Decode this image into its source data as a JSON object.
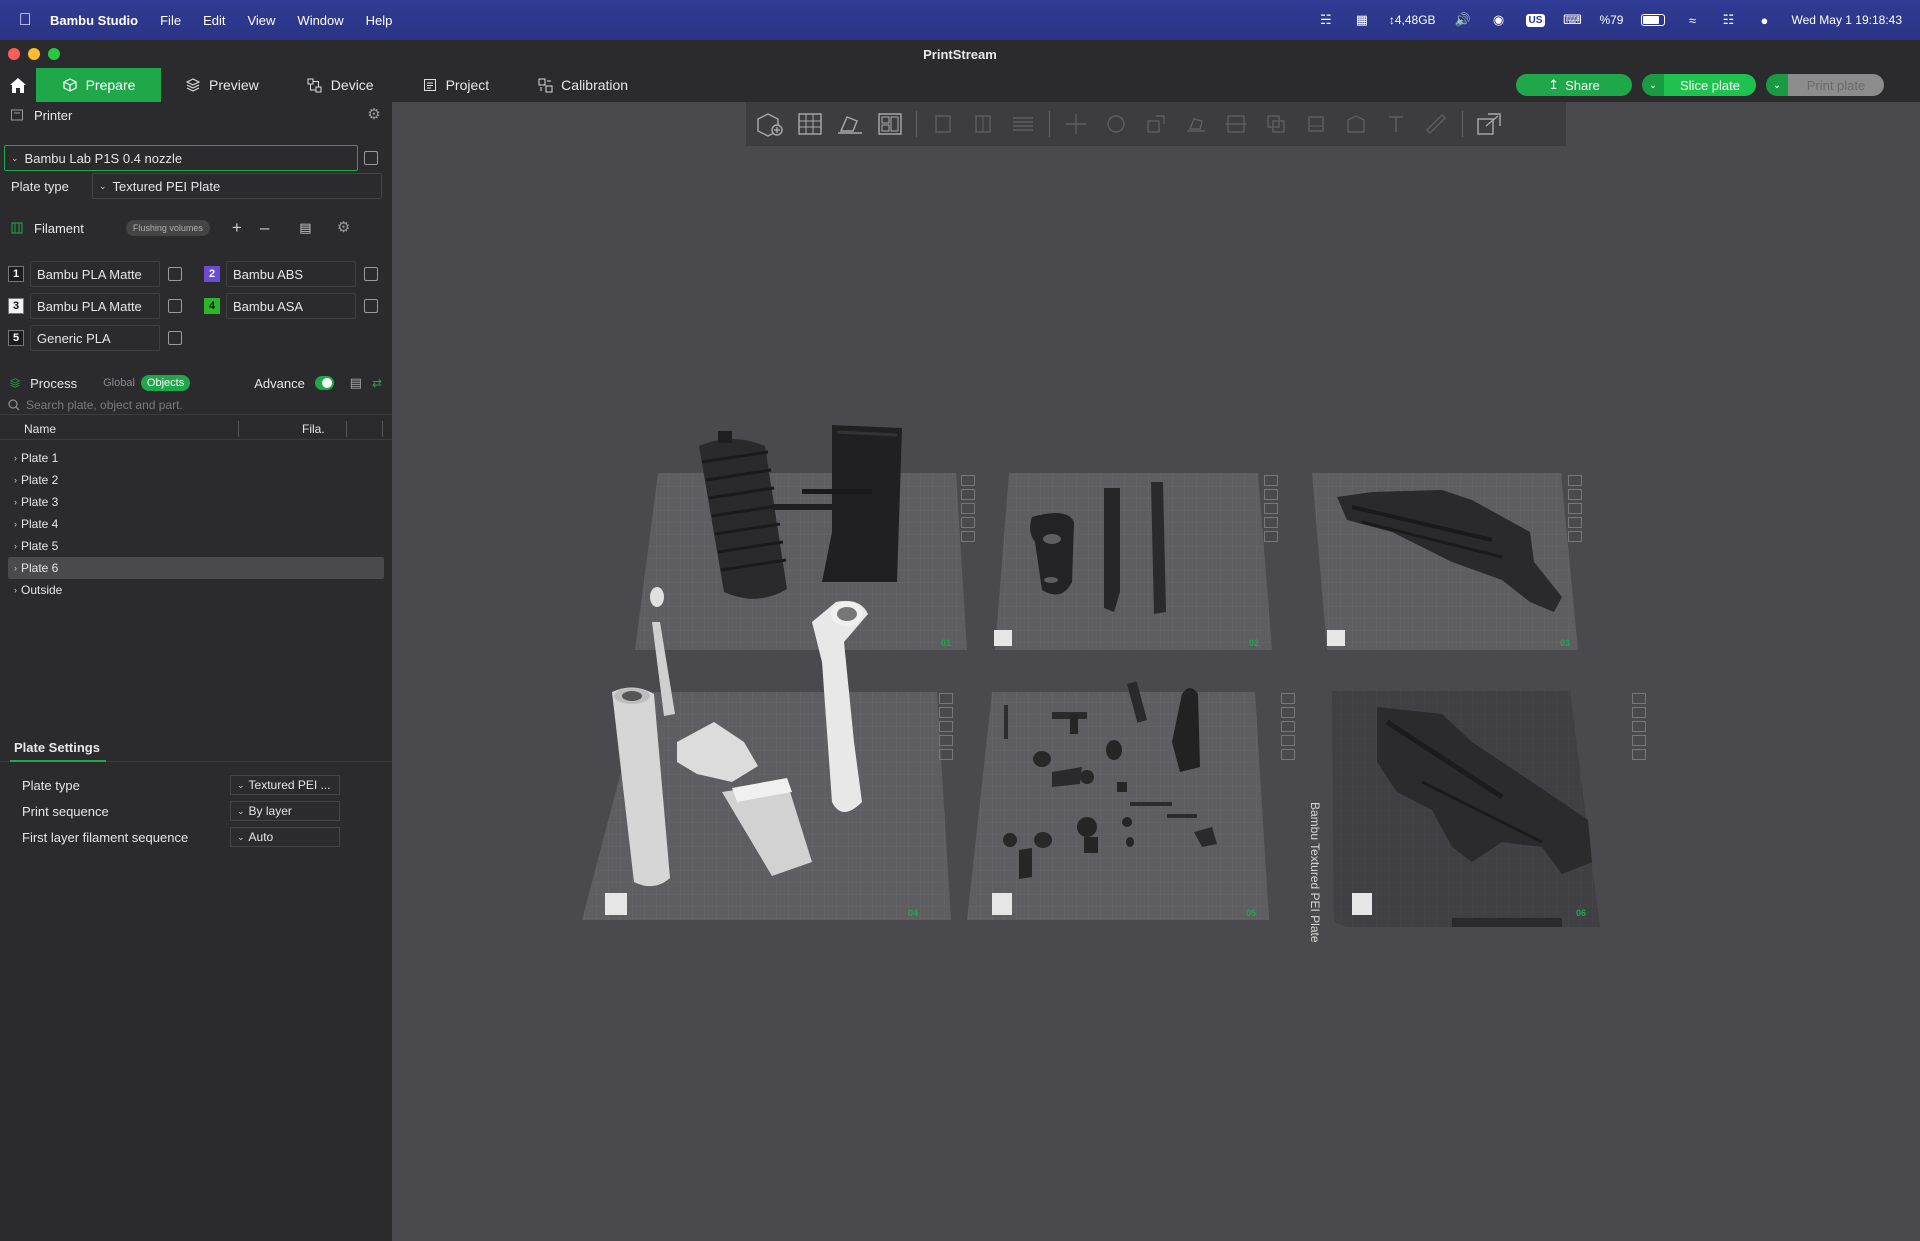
{
  "menubar": {
    "app_name": "Bambu Studio",
    "menus": [
      "File",
      "Edit",
      "View",
      "Window",
      "Help"
    ],
    "disk": "↕4,48GB",
    "input_source": "US",
    "battery": "%79",
    "datetime": "Wed May 1  19:18:43"
  },
  "window": {
    "title": "PrintStream"
  },
  "tabs": {
    "prepare": "Prepare",
    "preview": "Preview",
    "device": "Device",
    "project": "Project",
    "calibration": "Calibration"
  },
  "actions": {
    "share": "Share",
    "slice_plate": "Slice plate",
    "print_plate": "Print plate"
  },
  "printer": {
    "section_label": "Printer",
    "selected": "Bambu Lab P1S 0.4 nozzle",
    "plate_type_label": "Plate type",
    "plate_type_value": "Textured PEI Plate"
  },
  "filament": {
    "section_label": "Filament",
    "flushing_label": "Flushing volumes",
    "items": [
      {
        "num": "1",
        "name": "Bambu PLA Matte",
        "color": "#1c1c1c"
      },
      {
        "num": "2",
        "name": "Bambu ABS",
        "color": "#6a4bd6"
      },
      {
        "num": "3",
        "name": "Bambu PLA Matte",
        "color": "#f2f2f2"
      },
      {
        "num": "4",
        "name": "Bambu ASA",
        "color": "#2bb52b"
      },
      {
        "num": "5",
        "name": "Generic PLA",
        "color": "#1c1c1c"
      }
    ]
  },
  "process": {
    "section_label": "Process",
    "global_label": "Global",
    "objects_label": "Objects",
    "advance_label": "Advance",
    "search_placeholder": "Search plate, object and part.",
    "col_name": "Name",
    "col_fila": "Fila.",
    "tree": [
      "Plate 1",
      "Plate 2",
      "Plate 3",
      "Plate 4",
      "Plate 5",
      "Plate 6",
      "Outside"
    ]
  },
  "plate_settings": {
    "tab_label": "Plate Settings",
    "rows": [
      {
        "label": "Plate type",
        "value": "Textured PEI ..."
      },
      {
        "label": "Print sequence",
        "value": "By layer"
      },
      {
        "label": "First layer filament sequence",
        "value": "Auto"
      }
    ]
  },
  "plates": {
    "numbers": [
      "01",
      "02",
      "03",
      "04",
      "05",
      "06"
    ],
    "plate6_label": "Bambu Textured PEI Plate"
  },
  "colors": {
    "accent": "#1fa84a",
    "menubar": "#2d3890",
    "panel": "#2b2b2e",
    "canvas": "#4a4a4e"
  }
}
